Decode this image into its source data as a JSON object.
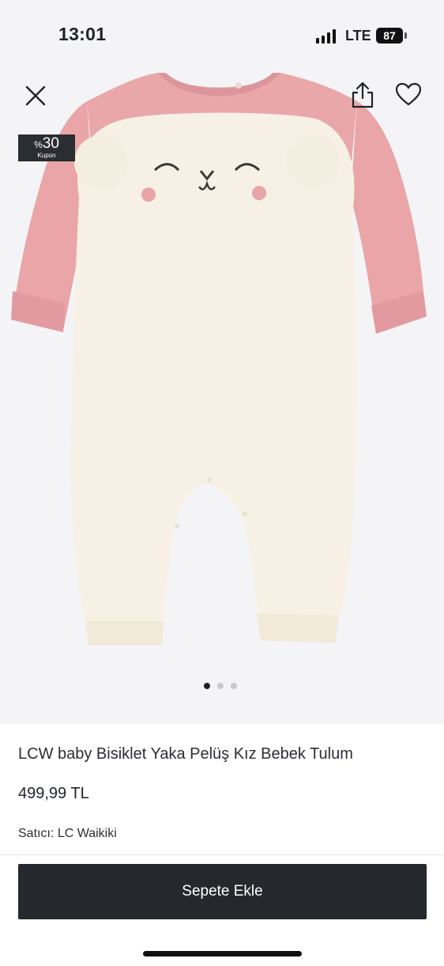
{
  "status_bar": {
    "time": "13:01",
    "network": "LTE",
    "battery": "87"
  },
  "header": {
    "close_icon": "close-icon",
    "share_icon": "share-icon",
    "favorite_icon": "heart-icon"
  },
  "coupon_badge": {
    "percent_sign": "%",
    "value": "30",
    "label": "Kupon"
  },
  "gallery": {
    "image_count": 3,
    "active_index": 0
  },
  "product": {
    "title": "LCW baby Bisiklet Yaka Pelüş Kız Bebek Tulum",
    "price": "499,99 TL",
    "seller_label": "Satıcı:",
    "seller_name": "LC Waikiki"
  },
  "cart": {
    "button_label": "Sepete Ekle"
  },
  "colors": {
    "accent": "#25292d",
    "sleeve_pink": "#e9a5a8",
    "plush_cream": "#f6f1e4",
    "background": "#f4f4f6"
  }
}
